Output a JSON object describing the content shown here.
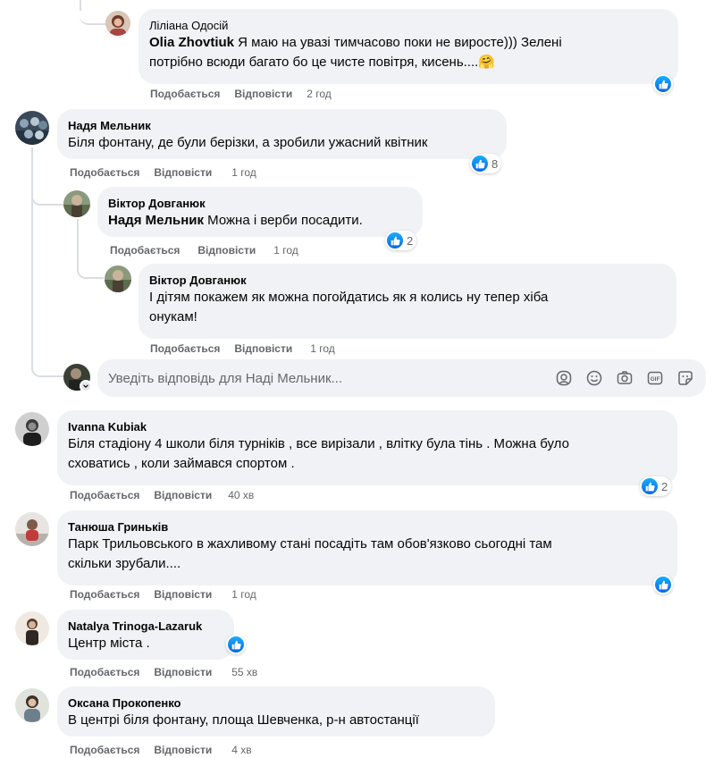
{
  "comments": [
    {
      "id": "c1",
      "author": "Ліліана Одосій",
      "mention": "Olia Zhovtiuk",
      "text_line1": " Я маю на увазі тимчасово поки не виросте))) Зелені",
      "text_line2": "потрібно всюди багато бо це чисте повітря, кисень....🤗",
      "like": "Подобається",
      "reply": "Відповісти",
      "time": "2 год",
      "reactions": ""
    },
    {
      "id": "c2",
      "author": "Надя Мельник",
      "text_line1": "Біля фонтану, де були берізки, а зробили ужасний квітник",
      "like": "Подобається",
      "reply": "Відповісти",
      "time": "1 год",
      "reactions": "8"
    },
    {
      "id": "c3",
      "author": "Віктор Довганюк",
      "mention": "Надя Мельник",
      "text_line1": " Можна і верби посадити.",
      "like": "Подобається",
      "reply": "Відповісти",
      "time": "1 год",
      "reactions": "2"
    },
    {
      "id": "c4",
      "author": "Віктор Довганюк",
      "text_line1": "І дітям покажем як можна погойдатись як я колись ну тепер хіба",
      "text_line2": "онукам!",
      "like": "Подобається",
      "reply": "Відповісти",
      "time": "1 год"
    },
    {
      "id": "c5",
      "author": "Ivanna Kubiak",
      "text_line1": "Біля стадіону 4 школи біля турніків , все вирізали , влітку була тінь . Можна було",
      "text_line2": "сховатись , коли займався спортом .",
      "like": "Подобається",
      "reply": "Відповісти",
      "time": "40 хв",
      "reactions": "2"
    },
    {
      "id": "c6",
      "author": "Танюша Гриньків",
      "text_line1": "Парк Трильовського в жахливому стані посадіть там обов'язково сьогодні там",
      "text_line2": "скільки зрубали....",
      "like": "Подобається",
      "reply": "Відповісти",
      "time": "1 год",
      "reactions": ""
    },
    {
      "id": "c7",
      "author": "Natalya Trinoga-Lazaruk",
      "text_line1": "Центр міста .",
      "like": "Подобається",
      "reply": "Відповісти",
      "time": "55 хв",
      "reactions": ""
    },
    {
      "id": "c8",
      "author": "Оксана Прокопенко",
      "text_line1": "В центрі біля фонтану, площа Шевченка, р-н автостанції",
      "like": "Подобається",
      "reply": "Відповісти",
      "time": "4 хв"
    }
  ],
  "reply_box": {
    "placeholder": "Уведіть відповідь для Наді Мельник..."
  },
  "icons": {
    "reaction": "like-icon",
    "reply_tools": [
      "avatar-sticker-icon",
      "emoji-icon",
      "camera-icon",
      "gif-icon",
      "sticker-icon"
    ]
  },
  "colors": {
    "bubble": "#f0f2f5",
    "like_blue": "#1877f2",
    "meta_text": "#65676b"
  }
}
